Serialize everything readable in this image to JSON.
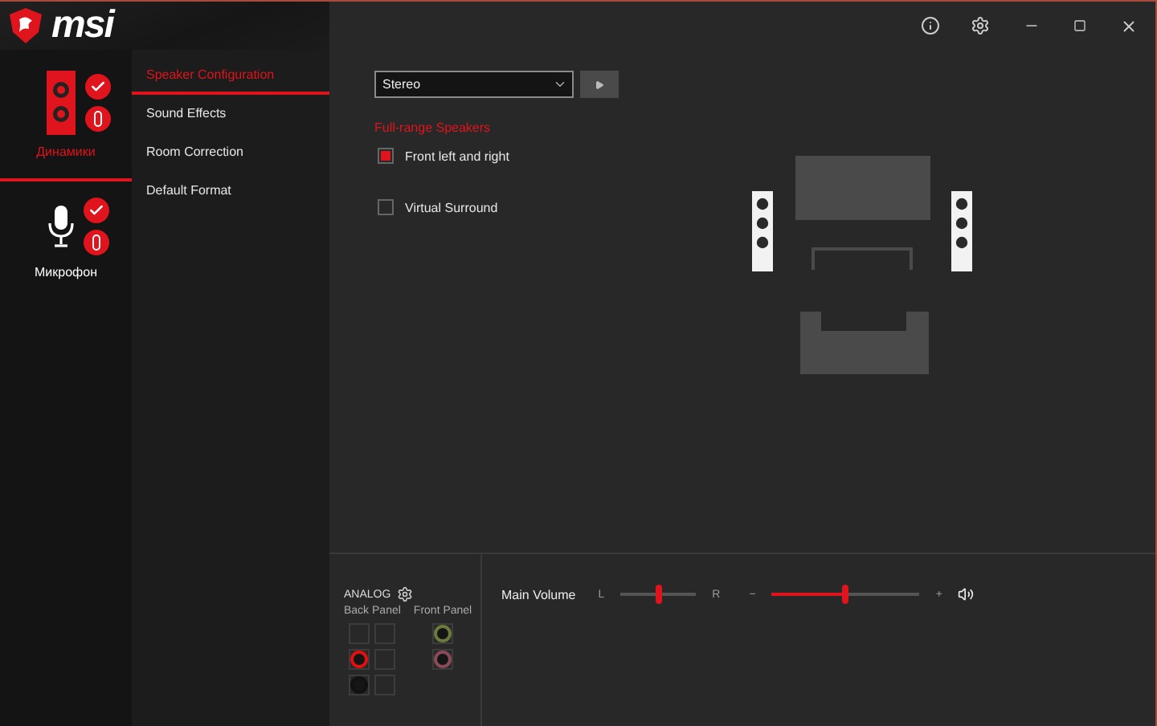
{
  "window": {
    "logo": "msi"
  },
  "devices": [
    {
      "label": "Динамики",
      "kind": "speaker",
      "selected": true
    },
    {
      "label": "Микрофон",
      "kind": "microphone",
      "selected": false
    }
  ],
  "nav": [
    {
      "label": "Speaker Configuration",
      "selected": true
    },
    {
      "label": "Sound Effects",
      "selected": false
    },
    {
      "label": "Room Correction",
      "selected": false
    },
    {
      "label": "Default Format",
      "selected": false
    }
  ],
  "config": {
    "dropdown": {
      "value": "Stereo"
    },
    "section_title": "Full-range Speakers",
    "options": [
      {
        "label": "Front left and right",
        "checked": true
      },
      {
        "label": "Virtual Surround",
        "checked": false
      }
    ]
  },
  "analog": {
    "title": "ANALOG",
    "back_label": "Back Panel",
    "front_label": "Front Panel",
    "back_jacks": [
      {
        "kind": "empty"
      },
      {
        "kind": "empty"
      },
      {
        "kind": "jack",
        "color": "#e01010"
      },
      {
        "kind": "empty"
      },
      {
        "kind": "jack",
        "color": "#111111"
      },
      {
        "kind": "empty"
      }
    ],
    "front_jacks": [
      {
        "kind": "jack",
        "color": "#6b7a3a"
      },
      {
        "kind": "jack",
        "color": "#8a4a5a"
      }
    ]
  },
  "volume": {
    "label": "Main Volume",
    "balance_left": "L",
    "balance_right": "R",
    "balance": {
      "level": 0.5
    },
    "minus": "−",
    "plus": "+",
    "level": 0.5
  }
}
